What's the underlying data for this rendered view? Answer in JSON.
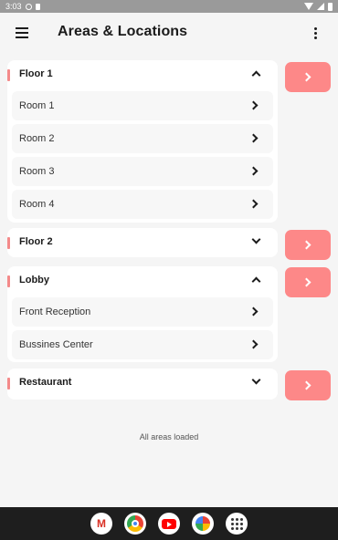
{
  "status_bar": {
    "time": "3:03"
  },
  "app_bar": {
    "title": "Areas & Locations",
    "menu_icon": "hamburger-menu-icon",
    "more_icon": "more-vert-icon"
  },
  "accent_color": "#fd8888",
  "areas": [
    {
      "name": "Floor 1",
      "expanded": true,
      "rooms": [
        "Room 1",
        "Room 2",
        "Room 3",
        "Room 4"
      ]
    },
    {
      "name": "Floor 2",
      "expanded": false,
      "rooms": []
    },
    {
      "name": "Lobby",
      "expanded": true,
      "rooms": [
        "Front Reception",
        "Bussines Center"
      ]
    },
    {
      "name": "Restaurant",
      "expanded": false,
      "rooms": []
    }
  ],
  "footer": {
    "message": "All areas loaded"
  },
  "dock": {
    "apps": [
      "gmail-icon",
      "chrome-icon",
      "youtube-icon",
      "photos-icon",
      "app-drawer-icon"
    ]
  }
}
